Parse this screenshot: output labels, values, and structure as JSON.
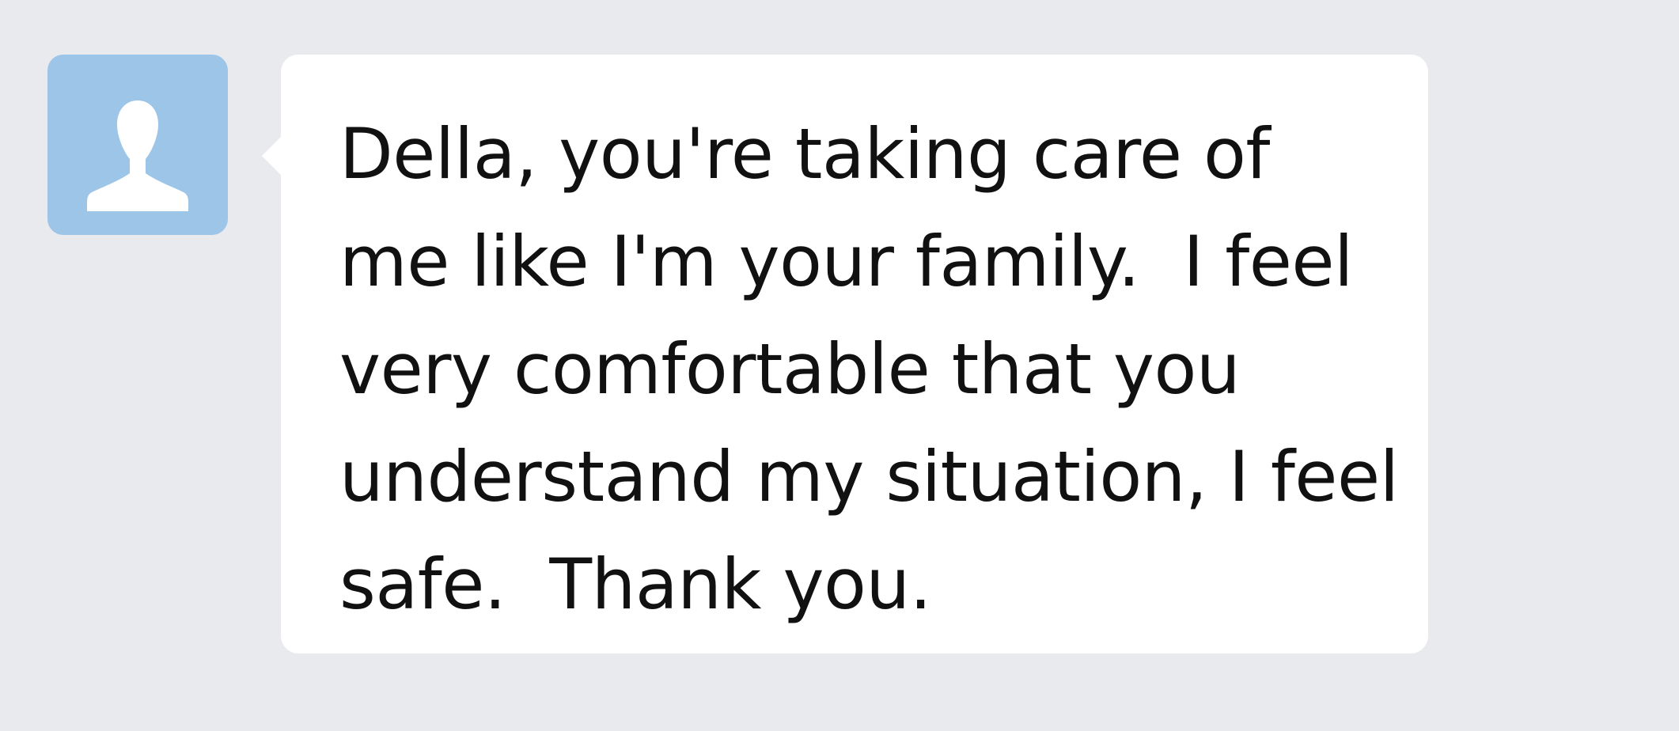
{
  "contact": {
    "avatar_icon": "person-silhouette-icon",
    "avatar_color": "#9dc5e8"
  },
  "message": {
    "lines": [
      "Della, you're taking care of",
      "me like I'm your family.  I feel",
      "very comfortable that you",
      "understand my situation, I feel",
      "safe.  Thank you."
    ],
    "bubble_color": "#ffffff"
  },
  "background_color": "#e9eaee"
}
